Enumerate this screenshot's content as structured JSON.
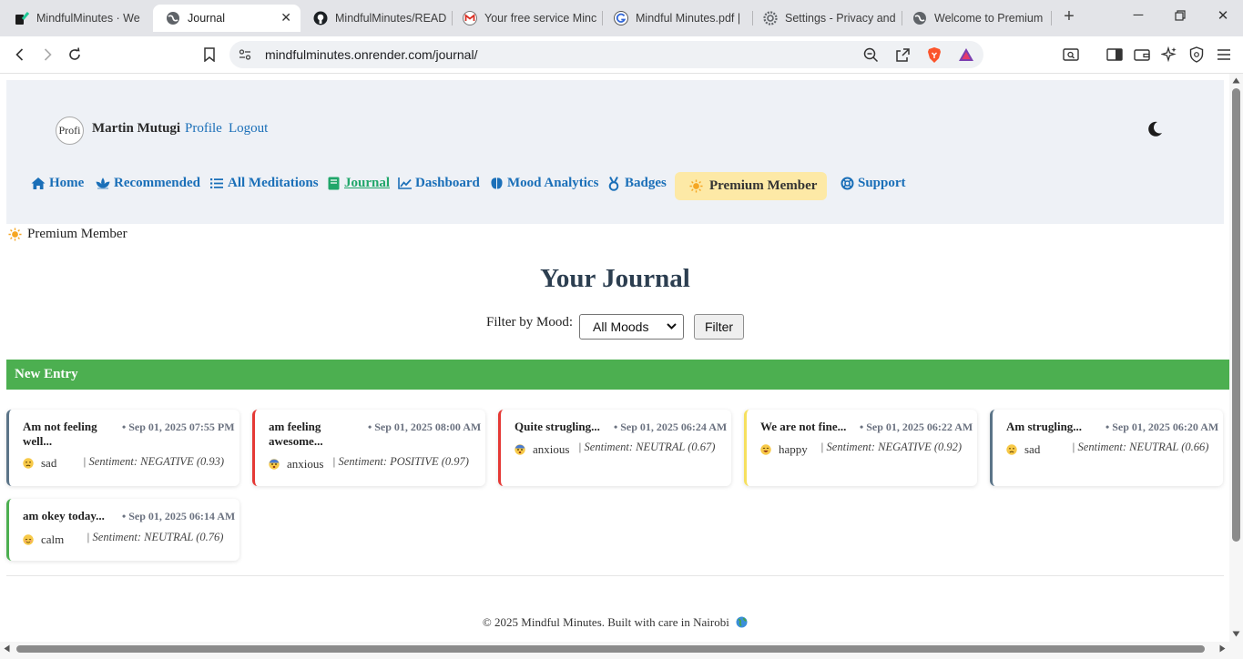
{
  "browser": {
    "tabs": [
      {
        "title": "MindfulMinutes · We",
        "icon": "mindful-favicon"
      },
      {
        "title": "Journal",
        "icon": "globe-icon",
        "active": true
      },
      {
        "title": "MindfulMinutes/READ",
        "icon": "github-icon"
      },
      {
        "title": "Your free service Minc",
        "icon": "gmail-icon"
      },
      {
        "title": "Mindful Minutes.pdf |",
        "icon": "drive-icon"
      },
      {
        "title": "Settings - Privacy and",
        "icon": "gear-icon"
      },
      {
        "title": "Welcome to Premium",
        "icon": "globe-icon"
      }
    ],
    "url": "mindfulminutes.onrender.com/journal/"
  },
  "header": {
    "avatar_alt": "Profi",
    "user_name": "Martin Mutugi",
    "profile_label": "Profile",
    "logout_label": "Logout"
  },
  "nav": {
    "home": "Home",
    "recommended": "Recommended",
    "all_meditations": "All Meditations",
    "journal": "Journal",
    "dashboard": "Dashboard",
    "mood_analytics": "Mood Analytics",
    "badges": "Badges",
    "premium": "Premium Member",
    "support": "Support"
  },
  "premium_banner": "Premium Member",
  "main": {
    "title": "Your Journal",
    "filter_label": "Filter by Mood:",
    "mood_selected": "All Moods",
    "filter_button": "Filter",
    "new_entry_label": "New Entry"
  },
  "entries": [
    {
      "title": "Am not feeling well...",
      "date": "• Sep 01, 2025 07:55 PM",
      "mood": "sad",
      "sentiment": "| Sentiment: NEGATIVE (0.93)",
      "accent": "#5b7488"
    },
    {
      "title": "am feeling awesome...",
      "date": "• Sep 01, 2025 08:00 AM",
      "mood": "anxious",
      "sentiment": "| Sentiment: POSITIVE (0.97)",
      "accent": "#e53935"
    },
    {
      "title": "Quite strugling...",
      "date": "• Sep 01, 2025 06:24 AM",
      "mood": "anxious",
      "sentiment": "| Sentiment: NEUTRAL (0.67)",
      "accent": "#e53935"
    },
    {
      "title": "We are not fine...",
      "date": "• Sep 01, 2025 06:22 AM",
      "mood": "happy",
      "sentiment": "| Sentiment: NEGATIVE (0.92)",
      "accent": "#f6e05e"
    },
    {
      "title": "Am strugling...",
      "date": "• Sep 01, 2025 06:20 AM",
      "mood": "sad",
      "sentiment": "| Sentiment: NEUTRAL (0.66)",
      "accent": "#5b7488"
    },
    {
      "title": "am okey today...",
      "date": "• Sep 01, 2025 06:14 AM",
      "mood": "calm",
      "sentiment": "| Sentiment: NEUTRAL (0.76)",
      "accent": "#4caf50"
    }
  ],
  "footer": "© 2025 Mindful Minutes. Built with care in Nairobi"
}
